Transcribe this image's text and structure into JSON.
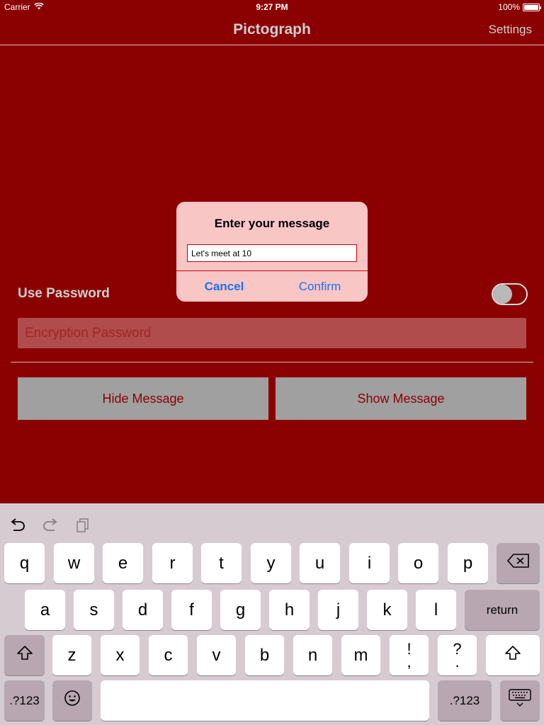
{
  "status_bar": {
    "carrier": "Carrier",
    "time": "9:27 PM",
    "battery": "100%",
    "battery_level": 1.0
  },
  "nav": {
    "title": "Pictograph",
    "settings_label": "Settings"
  },
  "password": {
    "label": "Use Password",
    "placeholder": "Encryption Password",
    "enabled": false
  },
  "actions": {
    "hide_label": "Hide Message",
    "show_label": "Show Message"
  },
  "alert": {
    "title": "Enter your message",
    "input_value": "Let's meet at 10",
    "cancel_label": "Cancel",
    "confirm_label": "Confirm"
  },
  "keyboard": {
    "row1": [
      "q",
      "w",
      "e",
      "r",
      "t",
      "y",
      "u",
      "i",
      "o",
      "p"
    ],
    "row2": [
      "a",
      "s",
      "d",
      "f",
      "g",
      "h",
      "j",
      "k",
      "l"
    ],
    "row3": [
      "z",
      "x",
      "c",
      "v",
      "b",
      "n",
      "m"
    ],
    "punct1_top": "!",
    "punct1_bottom": ",",
    "punct2_top": "?",
    "punct2_bottom": ".",
    "return_label": "return",
    "numbers_label": ".?123",
    "icons": [
      "undo-icon",
      "redo-icon",
      "paste-icon",
      "backspace-icon",
      "shift-icon",
      "emoji-icon",
      "keyboard-dismiss-icon"
    ]
  }
}
